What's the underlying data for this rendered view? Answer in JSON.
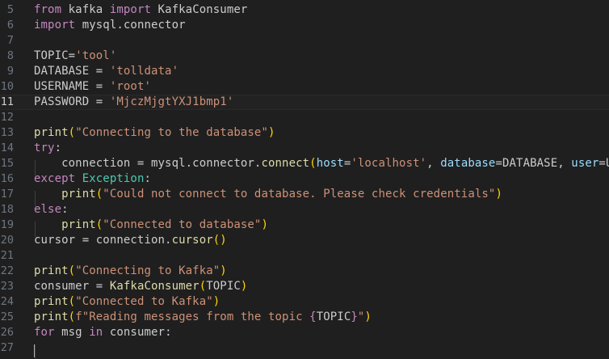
{
  "editor": {
    "language": "python",
    "current_line": "11",
    "colors": {
      "background": "#1f1f1f",
      "keyword": "#c586c0",
      "string": "#ce9178",
      "function": "#dcdcaa",
      "bracket": "#ffd700",
      "parameter": "#9cdcfe",
      "class": "#4ec9b0",
      "identifier": "#cccccc",
      "line_number": "#6e7681"
    },
    "lines": [
      {
        "number": "5",
        "tokens": [
          [
            "kw",
            "from"
          ],
          [
            "id",
            " kafka "
          ],
          [
            "kw",
            "import"
          ],
          [
            "id",
            " KafkaConsumer"
          ]
        ]
      },
      {
        "number": "6",
        "tokens": [
          [
            "kw",
            "import"
          ],
          [
            "id",
            " mysql.connector"
          ]
        ]
      },
      {
        "number": "7",
        "tokens": []
      },
      {
        "number": "8",
        "tokens": [
          [
            "id",
            "TOPIC="
          ],
          [
            "str",
            "'tool'"
          ]
        ]
      },
      {
        "number": "9",
        "tokens": [
          [
            "id",
            "DATABASE = "
          ],
          [
            "str",
            "'tolldata'"
          ]
        ]
      },
      {
        "number": "10",
        "tokens": [
          [
            "id",
            "USERNAME = "
          ],
          [
            "str",
            "'root'"
          ]
        ]
      },
      {
        "number": "11",
        "tokens": [
          [
            "id",
            "PASSWORD = "
          ],
          [
            "str",
            "'MjczMjgtYXJ1bmp1'"
          ]
        ]
      },
      {
        "number": "12",
        "tokens": []
      },
      {
        "number": "13",
        "tokens": [
          [
            "fn",
            "print"
          ],
          [
            "paren",
            "("
          ],
          [
            "str",
            "\"Connecting to the database\""
          ],
          [
            "paren",
            ")"
          ]
        ]
      },
      {
        "number": "14",
        "tokens": [
          [
            "kw",
            "try"
          ],
          [
            "id",
            ":"
          ]
        ]
      },
      {
        "number": "15",
        "tokens": [
          [
            "id",
            "    connection = mysql.connector."
          ],
          [
            "fn",
            "connect"
          ],
          [
            "paren",
            "("
          ],
          [
            "param",
            "host"
          ],
          [
            "id",
            "="
          ],
          [
            "str",
            "'localhost'"
          ],
          [
            "id",
            ", "
          ],
          [
            "param",
            "database"
          ],
          [
            "id",
            "=DATABASE, "
          ],
          [
            "param",
            "user"
          ],
          [
            "id",
            "=US"
          ]
        ]
      },
      {
        "number": "16",
        "tokens": [
          [
            "kw",
            "except"
          ],
          [
            "id",
            " "
          ],
          [
            "cls",
            "Exception"
          ],
          [
            "id",
            ":"
          ]
        ]
      },
      {
        "number": "17",
        "tokens": [
          [
            "fn",
            "    print"
          ],
          [
            "paren",
            "("
          ],
          [
            "str",
            "\"Could not connect to database. Please check credentials\""
          ],
          [
            "paren",
            ")"
          ]
        ]
      },
      {
        "number": "18",
        "tokens": [
          [
            "kw",
            "else"
          ],
          [
            "id",
            ":"
          ]
        ]
      },
      {
        "number": "19",
        "tokens": [
          [
            "fn",
            "    print"
          ],
          [
            "paren",
            "("
          ],
          [
            "str",
            "\"Connected to database\""
          ],
          [
            "paren",
            ")"
          ]
        ]
      },
      {
        "number": "20",
        "tokens": [
          [
            "id",
            "cursor = connection."
          ],
          [
            "fn",
            "cursor"
          ],
          [
            "paren",
            "()"
          ]
        ]
      },
      {
        "number": "21",
        "tokens": []
      },
      {
        "number": "22",
        "tokens": [
          [
            "fn",
            "print"
          ],
          [
            "paren",
            "("
          ],
          [
            "str",
            "\"Connecting to Kafka\""
          ],
          [
            "paren",
            ")"
          ]
        ]
      },
      {
        "number": "23",
        "tokens": [
          [
            "id",
            "consumer = "
          ],
          [
            "fn",
            "KafkaConsumer"
          ],
          [
            "paren",
            "("
          ],
          [
            "id",
            "TOPIC"
          ],
          [
            "paren",
            ")"
          ]
        ]
      },
      {
        "number": "24",
        "tokens": [
          [
            "fn",
            "print"
          ],
          [
            "paren",
            "("
          ],
          [
            "str",
            "\"Connected to Kafka\""
          ],
          [
            "paren",
            ")"
          ]
        ]
      },
      {
        "number": "25",
        "tokens": [
          [
            "fn",
            "print"
          ],
          [
            "paren",
            "("
          ],
          [
            "str",
            "f\"Reading messages from the topic "
          ],
          [
            "brace",
            "{"
          ],
          [
            "id",
            "TOPIC"
          ],
          [
            "brace",
            "}"
          ],
          [
            "str",
            "\""
          ],
          [
            "paren",
            ")"
          ]
        ]
      },
      {
        "number": "26",
        "tokens": [
          [
            "kw",
            "for"
          ],
          [
            "id",
            " msg "
          ],
          [
            "kw",
            "in"
          ],
          [
            "id",
            " consumer:"
          ]
        ]
      },
      {
        "number": "27",
        "tokens": []
      }
    ]
  }
}
